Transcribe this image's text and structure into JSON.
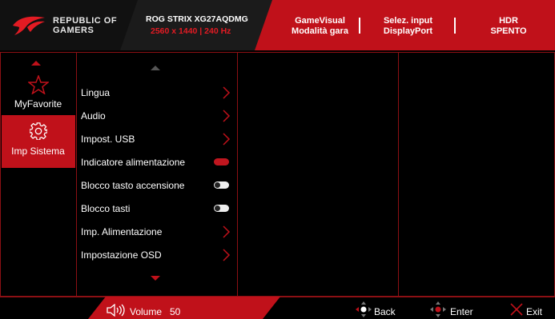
{
  "header": {
    "brand_line1": "REPUBLIC OF",
    "brand_line2": "GAMERS",
    "model_name": "ROG STRIX XG27AQDMG",
    "model_spec": "2560 x 1440  |  240 Hz",
    "gamevisual_label": "GameVisual",
    "gamevisual_value": "Modalità gara",
    "input_label": "Selez. input",
    "input_value": "DisplayPort",
    "hdr_label": "HDR",
    "hdr_value": "SPENTO"
  },
  "sidebar": {
    "items": [
      {
        "label": "MyFavorite",
        "icon": "star-icon",
        "selected": false
      },
      {
        "label": "Imp Sistema",
        "icon": "gear-icon",
        "selected": true
      }
    ]
  },
  "menu": {
    "items": [
      {
        "label": "Lingua",
        "control": "chevron"
      },
      {
        "label": "Audio",
        "control": "chevron"
      },
      {
        "label": "Impost. USB",
        "control": "chevron"
      },
      {
        "label": "Indicatore alimentazione",
        "control": "toggle",
        "state": "on"
      },
      {
        "label": "Blocco tasto accensione",
        "control": "toggle",
        "state": "off"
      },
      {
        "label": "Blocco tasti",
        "control": "toggle",
        "state": "off"
      },
      {
        "label": "Imp. Alimentazione",
        "control": "chevron"
      },
      {
        "label": "Impostazione OSD",
        "control": "chevron"
      }
    ]
  },
  "footer": {
    "volume_label": "Volume",
    "volume_value": "50",
    "back_label": "Back",
    "enter_label": "Enter",
    "exit_label": "Exit"
  },
  "colors": {
    "accent": "#c0111a",
    "background": "#000000",
    "border": "#8c1014"
  }
}
